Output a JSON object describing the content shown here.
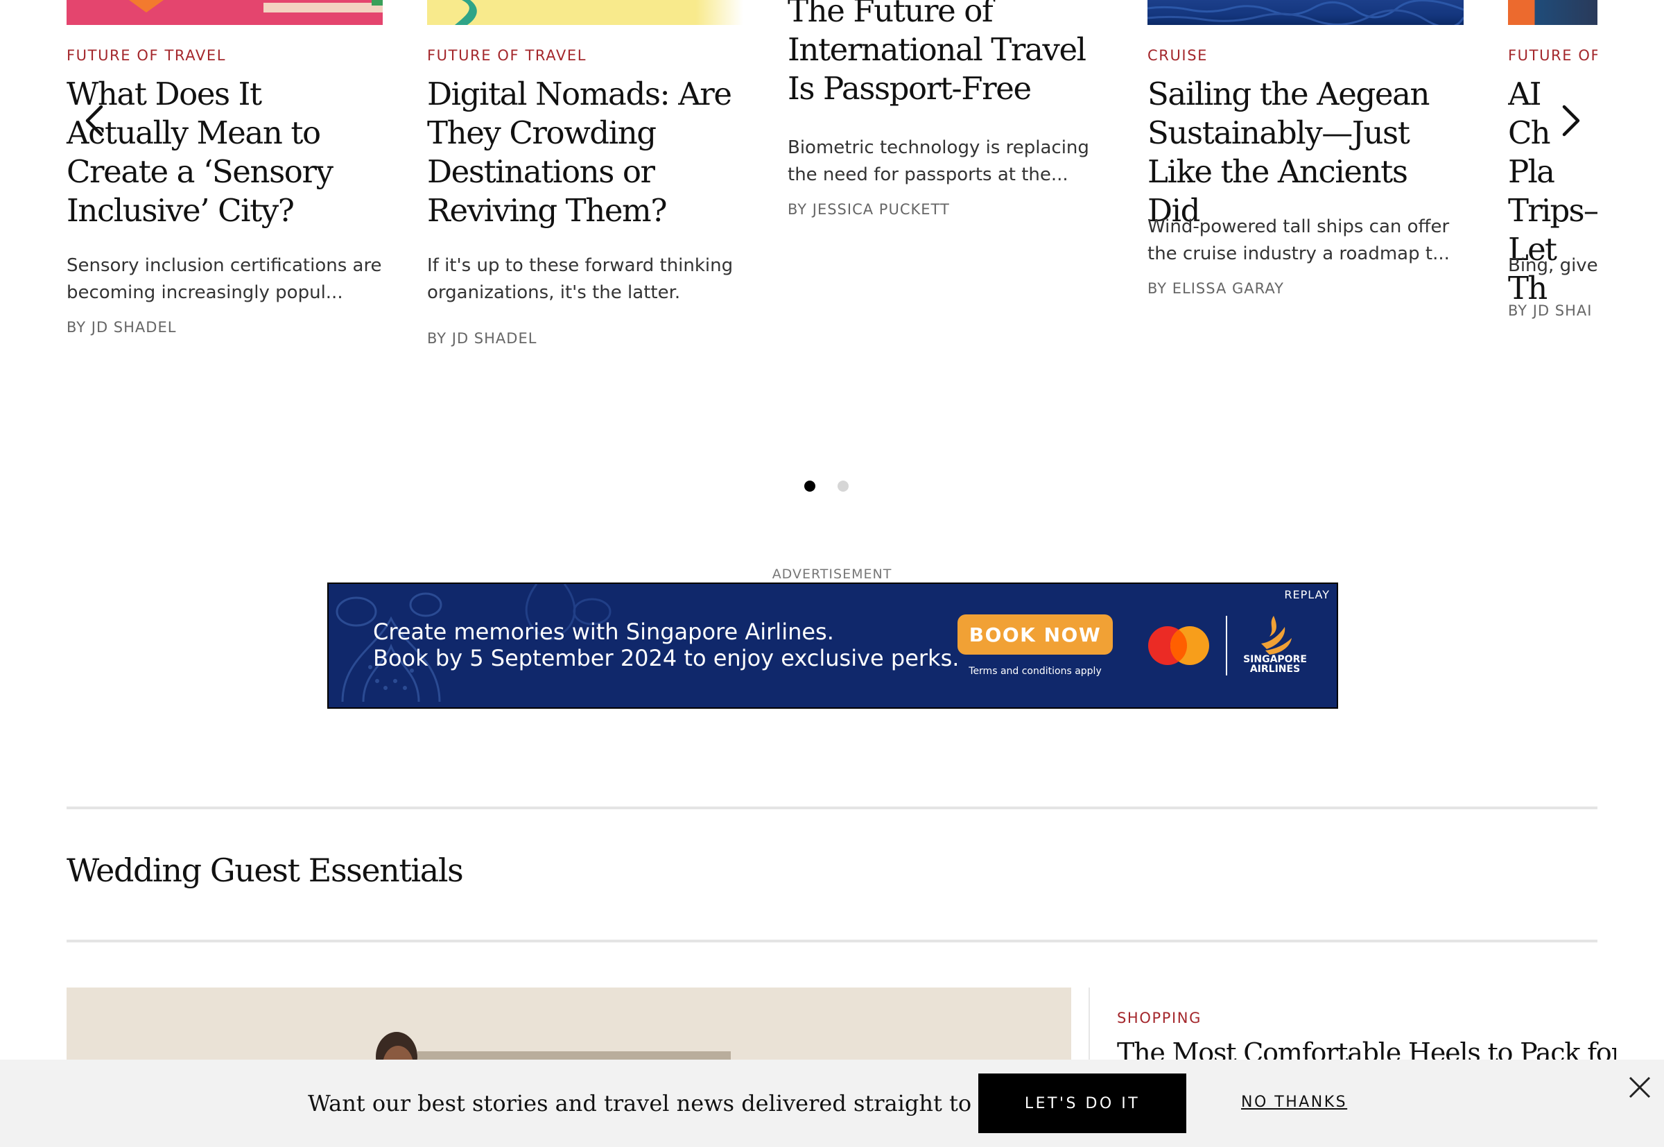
{
  "carousel": {
    "cards": [
      {
        "kicker": "FUTURE OF TRAVEL",
        "headline": "What Does It Actually Mean to Create a ‘Sensory Inclusive’ City?",
        "dek": "Sensory inclusion certifications are becoming increasingly popul...",
        "byline": "BY JD SHADEL"
      },
      {
        "kicker": "FUTURE OF TRAVEL",
        "headline": "Digital Nomads: Are They Crowding Destinations or Reviving Them?",
        "dek": "If it's up to these forward thinking organizations, it's the latter.",
        "byline": "BY JD SHADEL"
      },
      {
        "kicker": "",
        "headline": "The Future of International Travel Is Passport-Free",
        "dek": "Biometric technology is replacing the need for passports at the...",
        "byline": "BY JESSICA PUCKETT"
      },
      {
        "kicker": "CRUISE",
        "headline": "Sailing the Aegean Sustainably—Just Like the Ancients Did",
        "dek": "Wind-powered tall ships can offer the cruise industry a roadmap t...",
        "byline": "BY ELISSA GARAY"
      },
      {
        "kicker": "FUTURE OF",
        "headline": "AI Ch Pla Trips— Let Th",
        "dek": "Bing, give",
        "byline": "BY JD SHAI"
      }
    ],
    "prev_icon": "chevron-left-icon",
    "next_icon": "chevron-right-icon",
    "pages": 2,
    "active_page": 1
  },
  "ad": {
    "label": "ADVERTISEMENT",
    "line1": "Create memories with Singapore Airlines.",
    "line2": "Book by 5 September 2024 to enjoy exclusive perks.",
    "cta": "BOOK NOW",
    "terms": "Terms and conditions apply",
    "replay": "REPLAY",
    "brand_line1": "SINGAPORE",
    "brand_line2": "AIRLINES",
    "background_color": "#10286b",
    "cta_color": "#f1a135"
  },
  "section": {
    "title": "Wedding Guest Essentials"
  },
  "feature": {
    "kicker": "SHOPPING",
    "headline": "The Most Comfortable Heels to Pack for a"
  },
  "newsletter": {
    "prompt": "Want our best stories and travel news delivered straight to you?",
    "cta": "LET'S DO IT",
    "decline": "NO THANKS",
    "close_icon": "close-icon"
  },
  "colors": {
    "kicker": "#a4272c",
    "text": "#111111",
    "byline": "#666666"
  }
}
